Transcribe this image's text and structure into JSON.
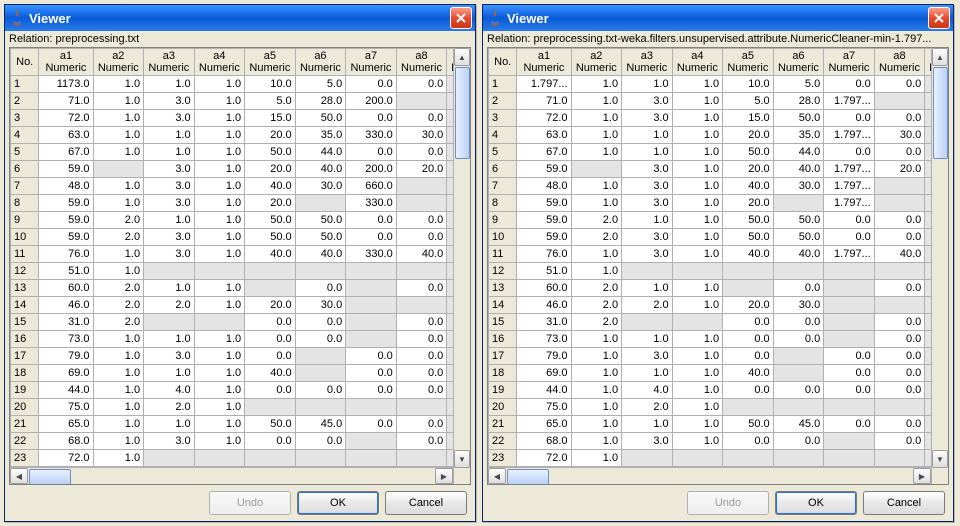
{
  "buttons": {
    "undo": "Undo",
    "ok": "OK",
    "cancel": "Cancel"
  },
  "relationLabel": "Relation:",
  "columns": [
    "a1",
    "a2",
    "a3",
    "a4",
    "a5",
    "a6",
    "a7",
    "a8"
  ],
  "colType": "Numeric",
  "partialCol": "a",
  "partialType": "Nu",
  "noHead": "No.",
  "windows": [
    {
      "title": "Viewer",
      "relation": "preprocessing.txt",
      "rows": [
        {
          "no": 1,
          "c": [
            "1173.0",
            "1.0",
            "1.0",
            "1.0",
            "10.0",
            "5.0",
            "0.0",
            "0.0"
          ]
        },
        {
          "no": 2,
          "c": [
            "71.0",
            "1.0",
            "3.0",
            "1.0",
            "5.0",
            "28.0",
            "200.0",
            ""
          ]
        },
        {
          "no": 3,
          "c": [
            "72.0",
            "1.0",
            "3.0",
            "1.0",
            "15.0",
            "50.0",
            "0.0",
            "0.0"
          ]
        },
        {
          "no": 4,
          "c": [
            "63.0",
            "1.0",
            "1.0",
            "1.0",
            "20.0",
            "35.0",
            "330.0",
            "30.0"
          ]
        },
        {
          "no": 5,
          "c": [
            "67.0",
            "1.0",
            "1.0",
            "1.0",
            "50.0",
            "44.0",
            "0.0",
            "0.0"
          ]
        },
        {
          "no": 6,
          "c": [
            "59.0",
            "",
            "3.0",
            "1.0",
            "20.0",
            "40.0",
            "200.0",
            "20.0"
          ]
        },
        {
          "no": 7,
          "c": [
            "48.0",
            "1.0",
            "3.0",
            "1.0",
            "40.0",
            "30.0",
            "660.0",
            ""
          ]
        },
        {
          "no": 8,
          "c": [
            "59.0",
            "1.0",
            "3.0",
            "1.0",
            "20.0",
            "",
            "330.0",
            ""
          ]
        },
        {
          "no": 9,
          "c": [
            "59.0",
            "2.0",
            "1.0",
            "1.0",
            "50.0",
            "50.0",
            "0.0",
            "0.0"
          ]
        },
        {
          "no": 10,
          "c": [
            "59.0",
            "2.0",
            "3.0",
            "1.0",
            "50.0",
            "50.0",
            "0.0",
            "0.0"
          ]
        },
        {
          "no": 11,
          "c": [
            "76.0",
            "1.0",
            "3.0",
            "1.0",
            "40.0",
            "40.0",
            "330.0",
            "40.0"
          ]
        },
        {
          "no": 12,
          "c": [
            "51.0",
            "1.0",
            "",
            "",
            "",
            "",
            "",
            ""
          ]
        },
        {
          "no": 13,
          "c": [
            "60.0",
            "2.0",
            "1.0",
            "1.0",
            "",
            "0.0",
            "",
            "0.0"
          ]
        },
        {
          "no": 14,
          "c": [
            "46.0",
            "2.0",
            "2.0",
            "1.0",
            "20.0",
            "30.0",
            "",
            ""
          ]
        },
        {
          "no": 15,
          "c": [
            "31.0",
            "2.0",
            "",
            "",
            "0.0",
            "0.0",
            "",
            "0.0"
          ]
        },
        {
          "no": 16,
          "c": [
            "73.0",
            "1.0",
            "1.0",
            "1.0",
            "0.0",
            "0.0",
            "",
            "0.0"
          ]
        },
        {
          "no": 17,
          "c": [
            "79.0",
            "1.0",
            "3.0",
            "1.0",
            "0.0",
            "",
            "0.0",
            "0.0"
          ]
        },
        {
          "no": 18,
          "c": [
            "69.0",
            "1.0",
            "1.0",
            "1.0",
            "40.0",
            "",
            "0.0",
            "0.0"
          ]
        },
        {
          "no": 19,
          "c": [
            "44.0",
            "1.0",
            "4.0",
            "1.0",
            "0.0",
            "0.0",
            "0.0",
            "0.0"
          ]
        },
        {
          "no": 20,
          "c": [
            "75.0",
            "1.0",
            "2.0",
            "1.0",
            "",
            "",
            "",
            ""
          ]
        },
        {
          "no": 21,
          "c": [
            "65.0",
            "1.0",
            "1.0",
            "1.0",
            "50.0",
            "45.0",
            "0.0",
            "0.0"
          ]
        },
        {
          "no": 22,
          "c": [
            "68.0",
            "1.0",
            "3.0",
            "1.0",
            "0.0",
            "0.0",
            "",
            "0.0"
          ]
        },
        {
          "no": 23,
          "c": [
            "72.0",
            "1.0",
            "",
            "",
            "",
            "",
            "",
            ""
          ]
        }
      ]
    },
    {
      "title": "Viewer",
      "relation": "preprocessing.txt-weka.filters.unsupervised.attribute.NumericCleaner-min-1.797...",
      "rows": [
        {
          "no": 1,
          "c": [
            "1.797...",
            "1.0",
            "1.0",
            "1.0",
            "10.0",
            "5.0",
            "0.0",
            "0.0"
          ]
        },
        {
          "no": 2,
          "c": [
            "71.0",
            "1.0",
            "3.0",
            "1.0",
            "5.0",
            "28.0",
            "1.797...",
            ""
          ]
        },
        {
          "no": 3,
          "c": [
            "72.0",
            "1.0",
            "3.0",
            "1.0",
            "15.0",
            "50.0",
            "0.0",
            "0.0"
          ]
        },
        {
          "no": 4,
          "c": [
            "63.0",
            "1.0",
            "1.0",
            "1.0",
            "20.0",
            "35.0",
            "1.797...",
            "30.0"
          ]
        },
        {
          "no": 5,
          "c": [
            "67.0",
            "1.0",
            "1.0",
            "1.0",
            "50.0",
            "44.0",
            "0.0",
            "0.0"
          ]
        },
        {
          "no": 6,
          "c": [
            "59.0",
            "",
            "3.0",
            "1.0",
            "20.0",
            "40.0",
            "1.797...",
            "20.0"
          ]
        },
        {
          "no": 7,
          "c": [
            "48.0",
            "1.0",
            "3.0",
            "1.0",
            "40.0",
            "30.0",
            "1.797...",
            ""
          ]
        },
        {
          "no": 8,
          "c": [
            "59.0",
            "1.0",
            "3.0",
            "1.0",
            "20.0",
            "",
            "1.797...",
            ""
          ]
        },
        {
          "no": 9,
          "c": [
            "59.0",
            "2.0",
            "1.0",
            "1.0",
            "50.0",
            "50.0",
            "0.0",
            "0.0"
          ]
        },
        {
          "no": 10,
          "c": [
            "59.0",
            "2.0",
            "3.0",
            "1.0",
            "50.0",
            "50.0",
            "0.0",
            "0.0"
          ]
        },
        {
          "no": 11,
          "c": [
            "76.0",
            "1.0",
            "3.0",
            "1.0",
            "40.0",
            "40.0",
            "1.797...",
            "40.0"
          ]
        },
        {
          "no": 12,
          "c": [
            "51.0",
            "1.0",
            "",
            "",
            "",
            "",
            "",
            ""
          ]
        },
        {
          "no": 13,
          "c": [
            "60.0",
            "2.0",
            "1.0",
            "1.0",
            "",
            "0.0",
            "",
            "0.0"
          ]
        },
        {
          "no": 14,
          "c": [
            "46.0",
            "2.0",
            "2.0",
            "1.0",
            "20.0",
            "30.0",
            "",
            ""
          ]
        },
        {
          "no": 15,
          "c": [
            "31.0",
            "2.0",
            "",
            "",
            "0.0",
            "0.0",
            "",
            "0.0"
          ]
        },
        {
          "no": 16,
          "c": [
            "73.0",
            "1.0",
            "1.0",
            "1.0",
            "0.0",
            "0.0",
            "",
            "0.0"
          ]
        },
        {
          "no": 17,
          "c": [
            "79.0",
            "1.0",
            "3.0",
            "1.0",
            "0.0",
            "",
            "0.0",
            "0.0"
          ]
        },
        {
          "no": 18,
          "c": [
            "69.0",
            "1.0",
            "1.0",
            "1.0",
            "40.0",
            "",
            "0.0",
            "0.0"
          ]
        },
        {
          "no": 19,
          "c": [
            "44.0",
            "1.0",
            "4.0",
            "1.0",
            "0.0",
            "0.0",
            "0.0",
            "0.0"
          ]
        },
        {
          "no": 20,
          "c": [
            "75.0",
            "1.0",
            "2.0",
            "1.0",
            "",
            "",
            "",
            ""
          ]
        },
        {
          "no": 21,
          "c": [
            "65.0",
            "1.0",
            "1.0",
            "1.0",
            "50.0",
            "45.0",
            "0.0",
            "0.0"
          ]
        },
        {
          "no": 22,
          "c": [
            "68.0",
            "1.0",
            "3.0",
            "1.0",
            "0.0",
            "0.0",
            "",
            "0.0"
          ]
        },
        {
          "no": 23,
          "c": [
            "72.0",
            "1.0",
            "",
            "",
            "",
            "",
            "",
            ""
          ]
        }
      ]
    }
  ]
}
